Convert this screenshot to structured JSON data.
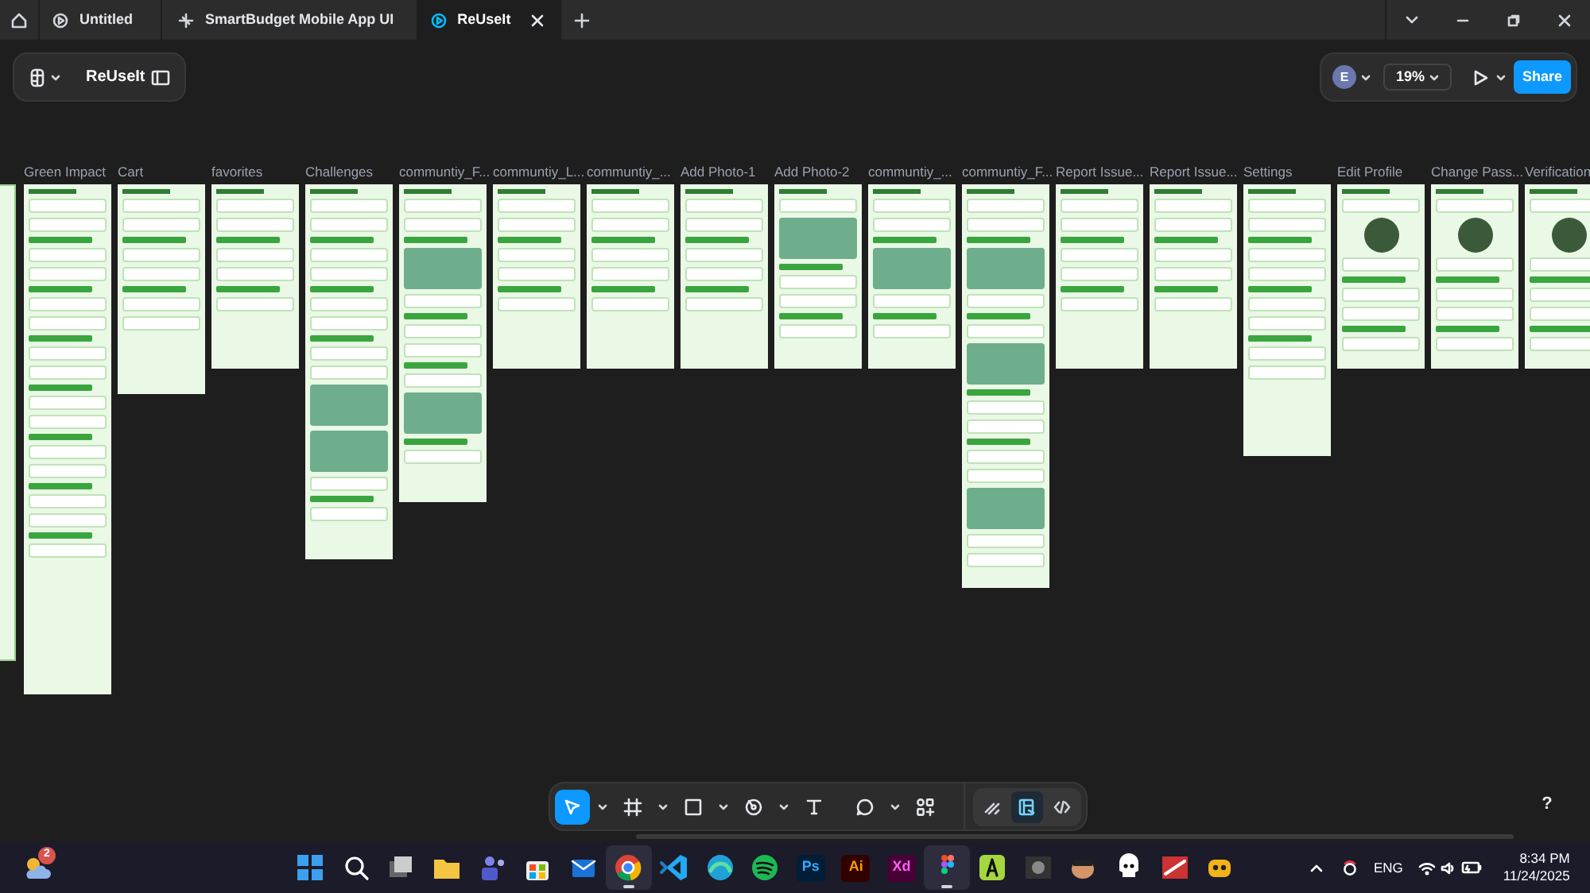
{
  "tabs": [
    {
      "kind": "file",
      "label": "Untitled",
      "selected": false
    },
    {
      "kind": "prototype",
      "label": "SmartBudget Mobile App UI",
      "selected": false
    },
    {
      "kind": "file",
      "label": "ReUseIt",
      "selected": true
    }
  ],
  "file_panel": {
    "title": "ReUseIt"
  },
  "share_panel": {
    "avatar": "E",
    "zoom": "19%",
    "share": "Share"
  },
  "frames": [
    {
      "label": "Green Impact"
    },
    {
      "label": "Cart"
    },
    {
      "label": "favorites"
    },
    {
      "label": "Challenges"
    },
    {
      "label": "communtiy_F..."
    },
    {
      "label": "communtiy_L..."
    },
    {
      "label": "communtiy_..."
    },
    {
      "label": "Add Photo-1"
    },
    {
      "label": "Add Photo-2"
    },
    {
      "label": "communtiy_..."
    },
    {
      "label": "communtiy_F..."
    },
    {
      "label": "Report Issue..."
    },
    {
      "label": "Report Issue..."
    },
    {
      "label": "Settings"
    },
    {
      "label": "Edit Profile"
    },
    {
      "label": "Change Pass..."
    },
    {
      "label": "Verification"
    }
  ],
  "tools": [
    {
      "kind": "move",
      "selected": true
    },
    {
      "kind": "frame",
      "selected": false
    },
    {
      "kind": "rectangle",
      "selected": false
    },
    {
      "kind": "pen",
      "selected": false
    },
    {
      "kind": "text",
      "selected": false
    },
    {
      "kind": "comment",
      "selected": false
    },
    {
      "kind": "actions",
      "selected": false
    }
  ],
  "modes": [
    {
      "kind": "draw",
      "selected": false
    },
    {
      "kind": "design",
      "selected": true
    },
    {
      "kind": "dev",
      "selected": false
    }
  ],
  "help": "?",
  "taskbar": {
    "weather_badge": "2",
    "apps": [
      {
        "kind": "start",
        "selected": false
      },
      {
        "kind": "search",
        "selected": false
      },
      {
        "kind": "taskview",
        "selected": false
      },
      {
        "kind": "folder",
        "selected": false
      },
      {
        "kind": "people",
        "selected": false
      },
      {
        "kind": "bag",
        "selected": false
      },
      {
        "kind": "mail",
        "selected": false
      },
      {
        "kind": "browser",
        "selected": true
      },
      {
        "kind": "code",
        "selected": false
      },
      {
        "kind": "wave",
        "selected": false
      },
      {
        "kind": "music",
        "selected": false
      },
      {
        "kind": "text",
        "label": "Ps",
        "selected": false
      },
      {
        "kind": "text",
        "label": "Ai",
        "selected": false
      },
      {
        "kind": "text",
        "label": "Xd",
        "selected": false
      },
      {
        "kind": "design",
        "selected": true
      },
      {
        "kind": "letter",
        "selected": false
      },
      {
        "kind": "game",
        "selected": false
      },
      {
        "kind": "character",
        "selected": false
      },
      {
        "kind": "skull",
        "selected": false
      },
      {
        "kind": "cover",
        "selected": false
      },
      {
        "kind": "robot",
        "selected": false
      }
    ],
    "language": "ENG",
    "time": "8:34 PM",
    "date": "11/24/2025"
  }
}
